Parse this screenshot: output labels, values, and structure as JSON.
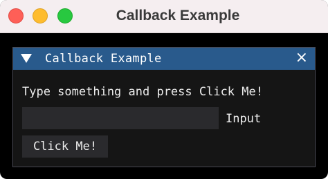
{
  "os_window": {
    "title": "Callback Example"
  },
  "imgui_window": {
    "title": "Callback Example",
    "close_icon": "×",
    "prompt_text": "Type something and press Click Me!",
    "input": {
      "value": "",
      "label": "Input"
    },
    "button_label": "Click Me!"
  },
  "colors": {
    "titlebar_active": "#295a8c",
    "window_bg": "#151515",
    "frame_bg": "#2a2a2d",
    "text": "#ececec"
  },
  "icons": {
    "collapse": "collapse-arrow-icon",
    "close": "close-icon"
  }
}
